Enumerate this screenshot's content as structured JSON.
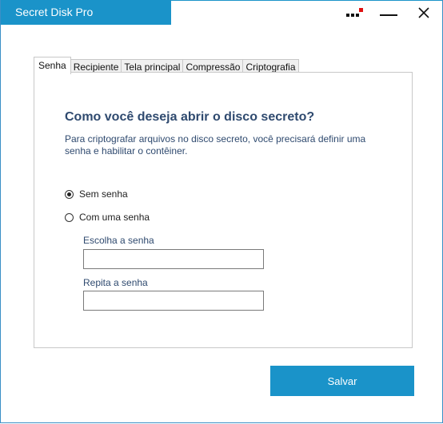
{
  "window": {
    "title": "Secret Disk Pro"
  },
  "colors": {
    "accent": "#1a93c9",
    "heading": "#2f4a6f",
    "menu_dot_red": "#e01010"
  },
  "tabs": [
    {
      "label": "Senha",
      "active": true
    },
    {
      "label": "Recipiente",
      "active": false
    },
    {
      "label": "Tela principal",
      "active": false
    },
    {
      "label": "Compressão",
      "active": false
    },
    {
      "label": "Criptografia",
      "active": false
    }
  ],
  "panel": {
    "heading": "Como você deseja abrir o disco secreto?",
    "description": "Para criptografar arquivos no disco secreto, você precisará definir uma senha e habilitar o contêiner.",
    "options": [
      {
        "label": "Sem senha",
        "selected": true
      },
      {
        "label": "Com uma senha",
        "selected": false
      }
    ],
    "password_label": "Escolha a senha",
    "password_value": "",
    "repeat_label": "Repita a senha",
    "repeat_value": ""
  },
  "actions": {
    "save_label": "Salvar"
  },
  "icons": {
    "menu": "dots-menu-icon",
    "minimize": "minimize-icon",
    "close": "close-icon"
  }
}
